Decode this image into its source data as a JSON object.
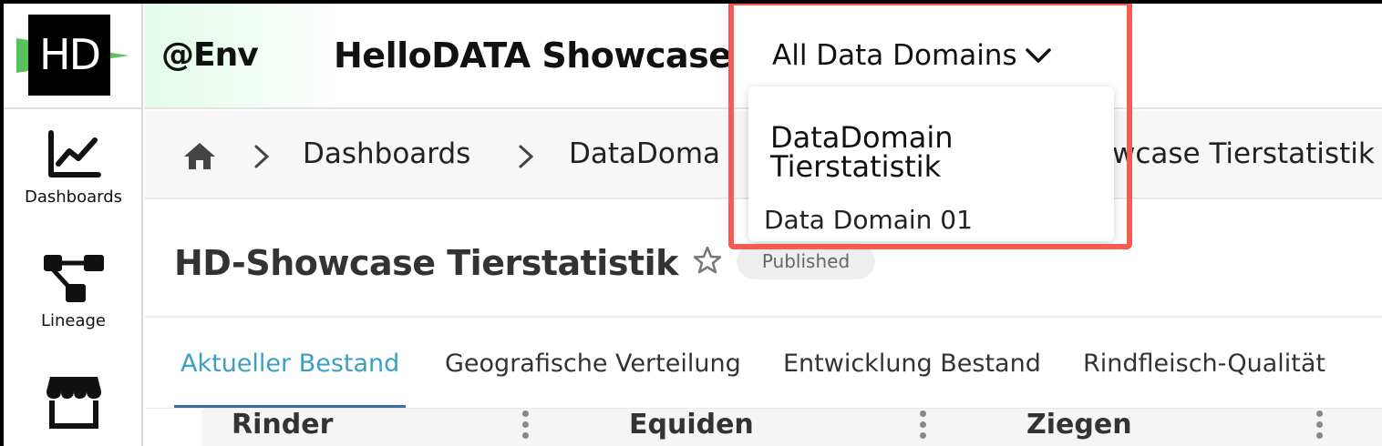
{
  "sidebar": {
    "logo_text": "HD",
    "items": [
      {
        "label": "Dashboards",
        "icon": "chart-line-icon"
      },
      {
        "label": "Lineage",
        "icon": "lineage-icon"
      },
      {
        "label": "",
        "icon": "store-icon"
      }
    ]
  },
  "header": {
    "env": "@Env",
    "title": "HelloDATA Showcase",
    "domain_select": "All Data Domains"
  },
  "domain_dropdown": {
    "options": [
      "DataDomain Tierstatistik",
      "Data Domain 01"
    ]
  },
  "breadcrumb": {
    "items": [
      "Dashboards",
      "DataDoma",
      "owcase Tierstatistik"
    ]
  },
  "page": {
    "title": "HD-Showcase Tierstatistik",
    "badge": "Published"
  },
  "tabs": [
    {
      "label": "Aktueller Bestand",
      "active": true
    },
    {
      "label": "Geografische Verteilung",
      "active": false
    },
    {
      "label": "Entwicklung Bestand",
      "active": false
    },
    {
      "label": "Rindfleisch-Qualität",
      "active": false
    }
  ],
  "cards": [
    {
      "title": "Rinder"
    },
    {
      "title": "Equiden"
    },
    {
      "title": "Ziegen"
    }
  ],
  "colors": {
    "accent": "#3a9fc5",
    "highlight": "#f25c54",
    "logo_green": "#57c15c"
  }
}
